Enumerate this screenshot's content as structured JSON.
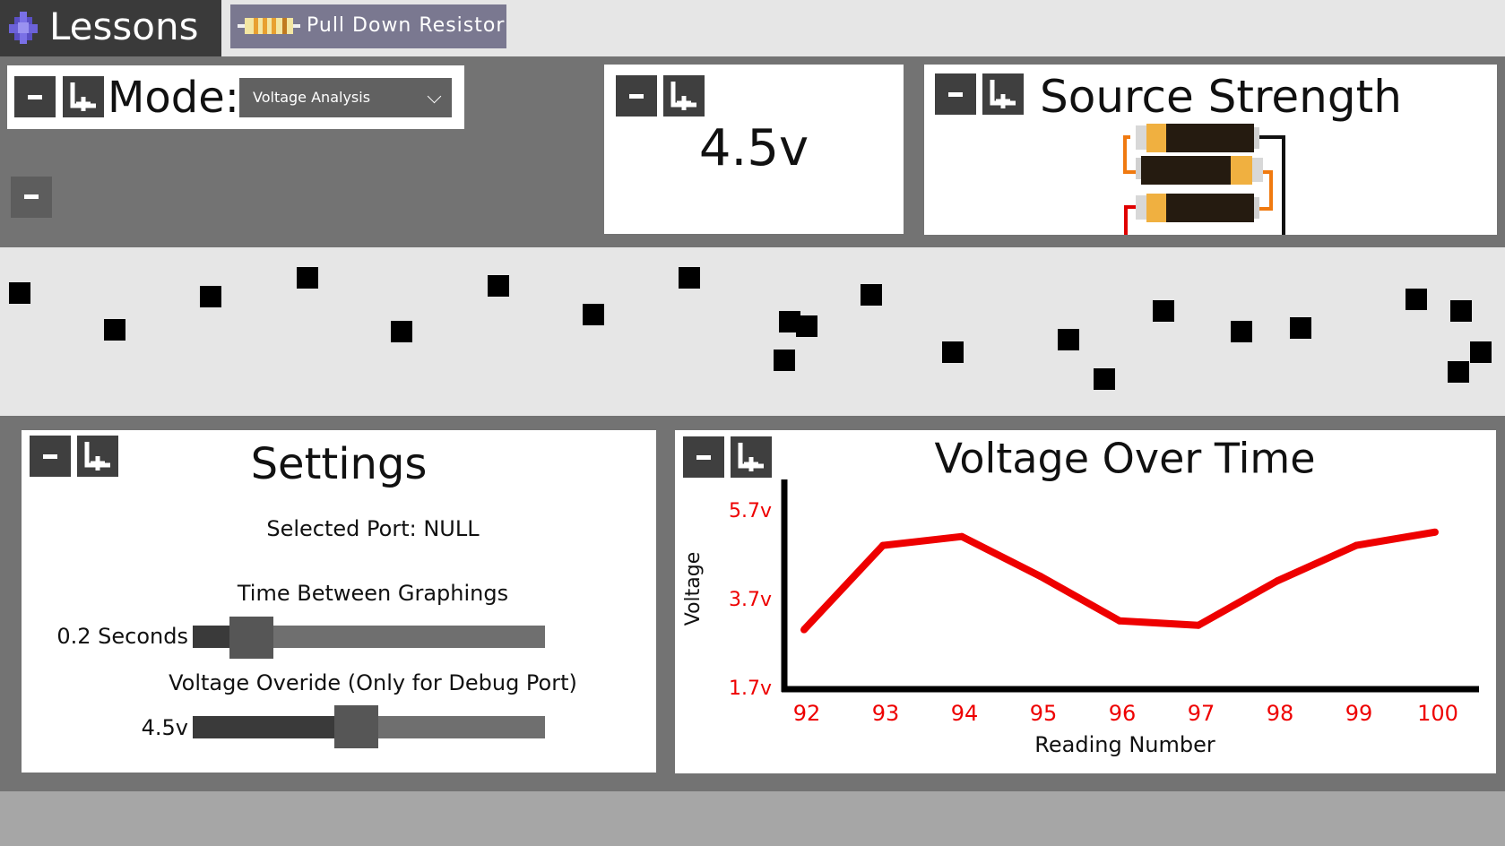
{
  "header": {
    "lessons_label": "Lessons",
    "lesson_name": "Pull Down Resistor"
  },
  "mode_panel": {
    "label": "Mode:",
    "selected": "Voltage Analysis"
  },
  "voltage_panel": {
    "value": "4.5v"
  },
  "source_panel": {
    "title": "Source Strength"
  },
  "colors": {
    "panel_bg": "#ffffff",
    "dark_area": "#737373",
    "button": "#3f3f3f",
    "chart_line": "#ee0000",
    "chart_axis_labels": "#ee0000",
    "battery_accent": "#f0b040"
  },
  "icons": [
    "minus-icon",
    "crop-icon",
    "chevron-down-icon",
    "puzzle-icon",
    "resistor-icon",
    "battery-icon"
  ],
  "scatter": {
    "points": [
      [
        0.013,
        0.27
      ],
      [
        0.076,
        0.49
      ],
      [
        0.14,
        0.29
      ],
      [
        0.204,
        0.18
      ],
      [
        0.267,
        0.5
      ],
      [
        0.331,
        0.23
      ],
      [
        0.394,
        0.4
      ],
      [
        0.458,
        0.18
      ],
      [
        0.525,
        0.44
      ],
      [
        0.536,
        0.47
      ],
      [
        0.521,
        0.67
      ],
      [
        0.579,
        0.28
      ],
      [
        0.633,
        0.62
      ],
      [
        0.71,
        0.55
      ],
      [
        0.734,
        0.78
      ],
      [
        0.773,
        0.38
      ],
      [
        0.825,
        0.5
      ],
      [
        0.864,
        0.48
      ],
      [
        0.941,
        0.31
      ],
      [
        0.971,
        0.38
      ],
      [
        0.984,
        0.62
      ],
      [
        0.969,
        0.74
      ]
    ]
  },
  "settings": {
    "title": "Settings",
    "selected_port": "Selected Port: NULL",
    "time_between_label": "Time Between Graphings",
    "time_between_value": "0.2 Seconds",
    "time_between_fraction": 0.12,
    "voltage_override_label": "Voltage Overide (Only for Debug Port)",
    "voltage_override_value": "4.5v",
    "voltage_override_fraction": 0.46
  },
  "chart_data": {
    "type": "line",
    "title": "Voltage Over Time",
    "xlabel": "Reading Number",
    "ylabel": "Voltage",
    "categories": [
      "92",
      "93",
      "94",
      "95",
      "96",
      "97",
      "98",
      "99",
      "100"
    ],
    "y_ticks": [
      "5.7v",
      "3.7v",
      "1.7v"
    ],
    "y_tick_values": [
      5.7,
      3.7,
      1.7
    ],
    "ylim": [
      1.7,
      5.7
    ],
    "series": [
      {
        "values": [
          3.0,
          4.9,
          5.1,
          4.2,
          3.2,
          3.1,
          4.1,
          4.9,
          5.2
        ]
      }
    ]
  }
}
